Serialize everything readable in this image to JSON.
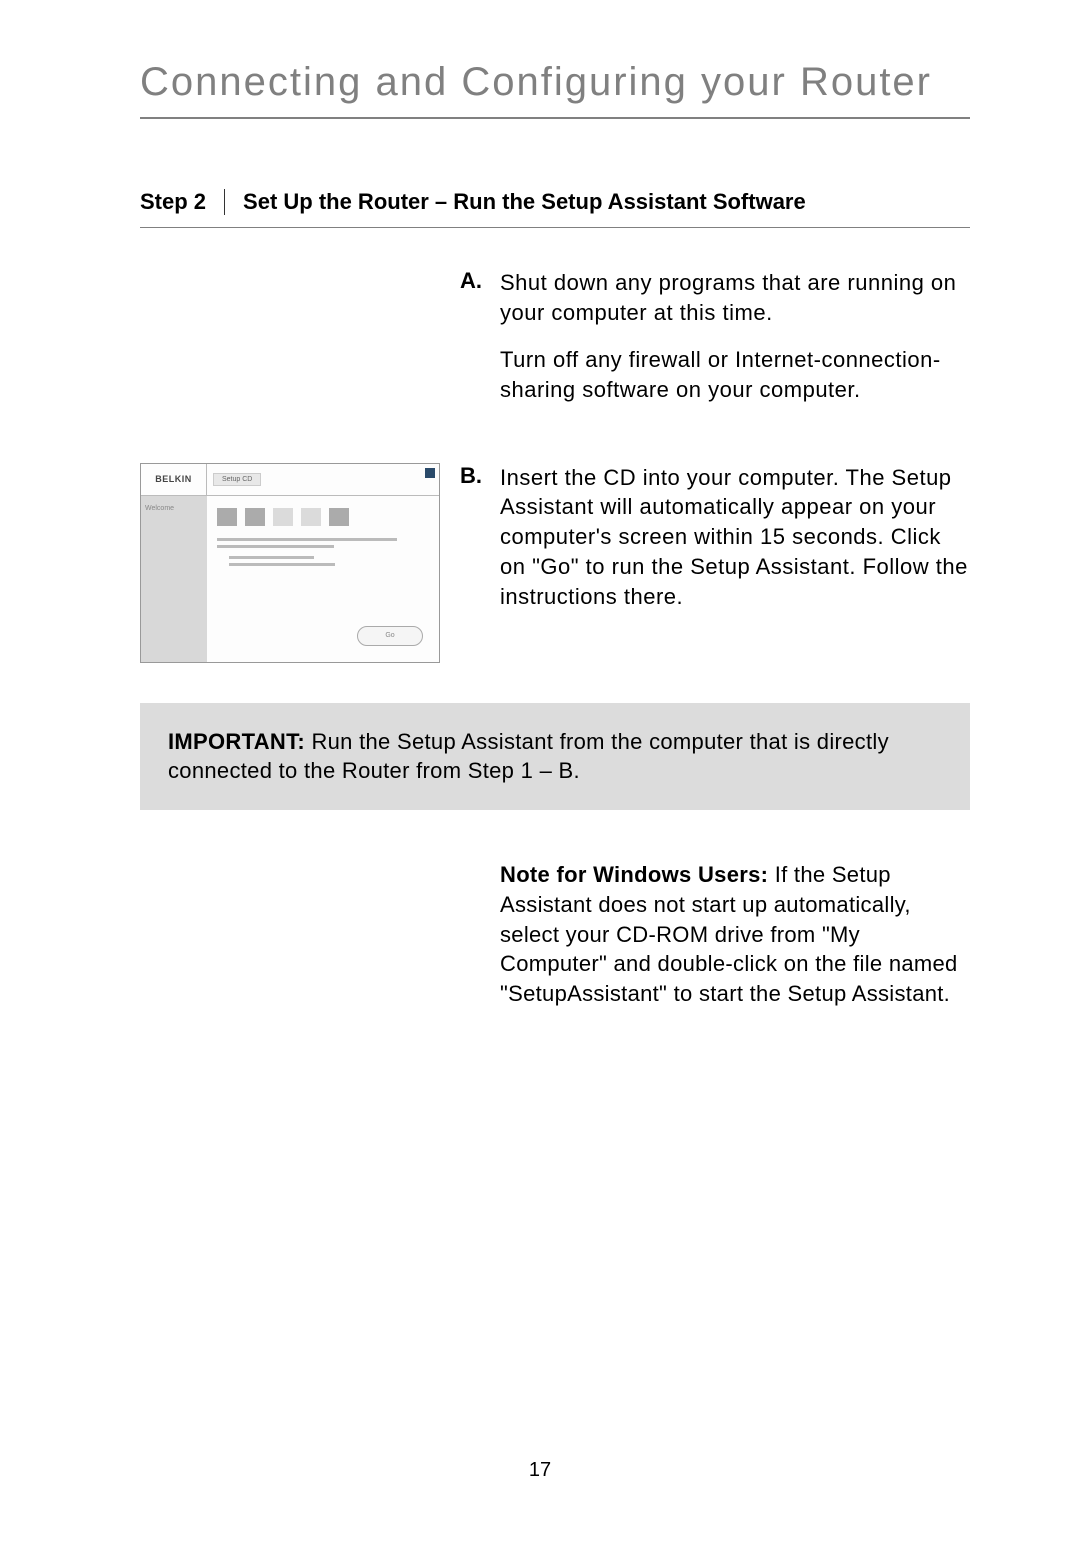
{
  "title": "Connecting and Configuring your Router",
  "step": {
    "label": "Step 2",
    "heading": "Set Up the Router – Run the Setup Assistant Software"
  },
  "itemA": {
    "letter": "A.",
    "para1": "Shut down any programs that are running on your computer at this time.",
    "para2": "Turn off any firewall or Internet-connection-sharing software on your computer."
  },
  "itemB": {
    "letter": "B.",
    "para1": "Insert the CD into your computer. The Setup Assistant will automatically appear on your computer's screen within 15 seconds. Click on \"Go\" to run the Setup Assistant. Follow the instructions there."
  },
  "thumbnail": {
    "brand": "BELKIN",
    "tab": "Setup CD",
    "sidebar": "Welcome",
    "button": "Go"
  },
  "important": {
    "label": "IMPORTANT:",
    "text": " Run the Setup Assistant from the computer that is directly connected to the Router from Step 1 – B."
  },
  "note": {
    "label": "Note for Windows Users:",
    "text": " If the Setup Assistant does not start up automatically, select your CD-ROM drive from \"My Computer\" and double-click on the file named \"SetupAssistant\" to start the Setup Assistant."
  },
  "pageNumber": "17"
}
